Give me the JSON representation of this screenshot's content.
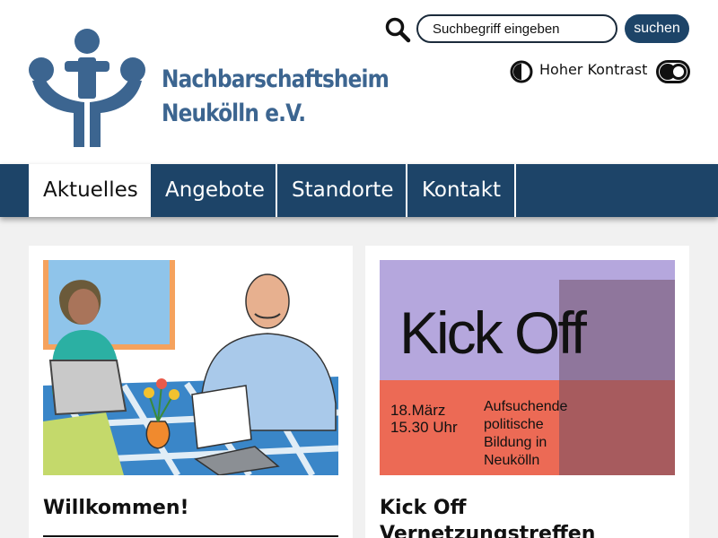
{
  "brand": {
    "name_line1": "Nachbarschaftsheim",
    "name_line2": "Neukölln e.V.",
    "color": "#3c6590"
  },
  "search": {
    "placeholder": "Suchbegriff eingeben",
    "button_label": "suchen"
  },
  "accessibility": {
    "contrast_label": "Hoher Kontrast"
  },
  "nav": {
    "items": [
      {
        "label": "Aktuelles",
        "active": true
      },
      {
        "label": "Angebote",
        "active": false
      },
      {
        "label": "Standorte",
        "active": false
      },
      {
        "label": "Kontakt",
        "active": false
      }
    ]
  },
  "cards": [
    {
      "title": "Willkommen!",
      "image": "illustration-two-people-at-table"
    },
    {
      "title": "Kick Off Vernetzungstreffen",
      "image": "kick-off-poster",
      "poster": {
        "headline": "Kick Off",
        "date": "18.März",
        "time": "15.30 Uhr",
        "subtitle_line1": "Aufsuchende",
        "subtitle_line2": "politische",
        "subtitle_line3": "Bildung in",
        "subtitle_line4": "Neukölln"
      }
    }
  ],
  "colors": {
    "navy": "#1d4468",
    "background": "#f1f1f1",
    "poster_purple": "#b5a7dd",
    "poster_red": "#ec6a55"
  }
}
